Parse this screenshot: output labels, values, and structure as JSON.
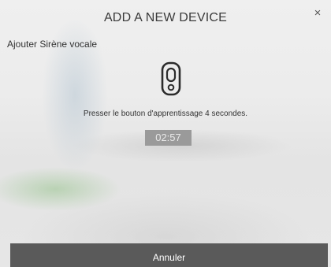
{
  "dialog": {
    "title": "ADD A NEW DEVICE",
    "close_icon": "×",
    "subtitle": "Ajouter Sirène vocale",
    "device_icon": "siren-device-icon",
    "instruction": "Presser le bouton d'apprentissage 4 secondes.",
    "timer": "02:57",
    "cancel_label": "Annuler"
  },
  "colors": {
    "timer_background": "#9a9a9a",
    "cancel_background": "#5a5a5a",
    "text": "#333333"
  }
}
